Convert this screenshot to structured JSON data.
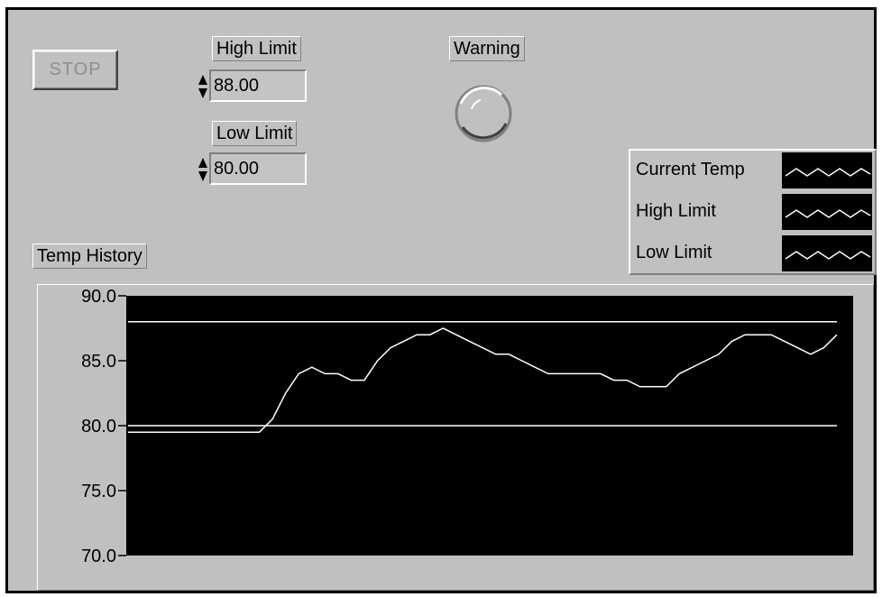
{
  "stop_button": {
    "label": "STOP"
  },
  "high_limit": {
    "label": "High Limit",
    "value": "88.00"
  },
  "low_limit": {
    "label": "Low Limit",
    "value": "80.00"
  },
  "warning": {
    "label": "Warning"
  },
  "legend": {
    "items": [
      {
        "label": "Current Temp"
      },
      {
        "label": "High Limit"
      },
      {
        "label": "Low Limit"
      }
    ]
  },
  "chart": {
    "label": "Temp History"
  },
  "chart_data": {
    "type": "line",
    "title": "Temp History",
    "xlabel": "",
    "ylabel": "",
    "ylim": [
      70,
      90
    ],
    "yticks": [
      "90.0",
      "85.0",
      "80.0",
      "75.0",
      "70.0"
    ],
    "grid": false,
    "legend_position": "top-right",
    "background": "#000000",
    "line_color": "#ffffff",
    "series": [
      {
        "name": "Current Temp",
        "values": [
          79.5,
          79.5,
          79.5,
          79.5,
          79.5,
          79.5,
          79.5,
          79.5,
          79.5,
          79.5,
          79.5,
          80.5,
          82.5,
          84.0,
          84.5,
          84.0,
          84.0,
          83.5,
          83.5,
          85.0,
          86.0,
          86.5,
          87.0,
          87.0,
          87.5,
          87.0,
          86.5,
          86.0,
          85.5,
          85.5,
          85.0,
          84.5,
          84.0,
          84.0,
          84.0,
          84.0,
          84.0,
          83.5,
          83.5,
          83.0,
          83.0,
          83.0,
          84.0,
          84.5,
          85.0,
          85.5,
          86.5,
          87.0,
          87.0,
          87.0,
          86.5,
          86.0,
          85.5,
          86.0,
          87.0
        ]
      },
      {
        "name": "High Limit",
        "values": [
          88.0,
          88.0
        ]
      },
      {
        "name": "Low Limit",
        "values": [
          80.0,
          80.0
        ]
      }
    ]
  }
}
